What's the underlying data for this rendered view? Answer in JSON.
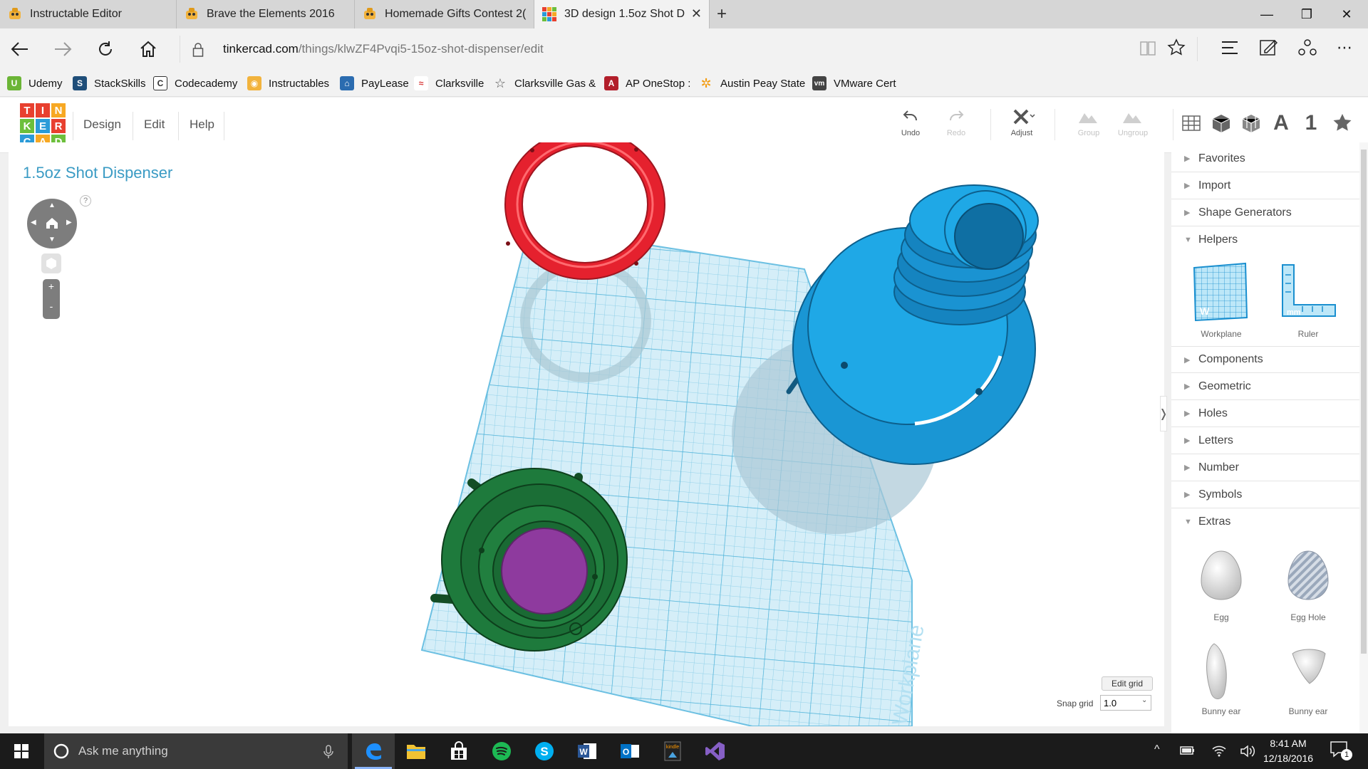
{
  "browser": {
    "tabs": [
      {
        "title": "Instructable Editor",
        "active": false
      },
      {
        "title": "Brave the Elements 2016",
        "active": false
      },
      {
        "title": "Homemade Gifts Contest 2(",
        "active": false
      },
      {
        "title": "3D design 1.5oz Shot D",
        "active": true
      }
    ],
    "new_tab_label": "+",
    "url_host": "tinkercad.com",
    "url_path": "/things/klwZF4Pvqi5-15oz-shot-dispenser/edit",
    "favorites": [
      {
        "label": "Udemy",
        "icon": "udemy-icon",
        "color": "#6bb536"
      },
      {
        "label": "StackSkills",
        "icon": "stackskills-icon",
        "color": "#1f4e79"
      },
      {
        "label": "Codecademy",
        "icon": "codecademy-icon",
        "color": "#333333"
      },
      {
        "label": "Instructables",
        "icon": "instructables-icon",
        "color": "#f2b33d"
      },
      {
        "label": "PayLease",
        "icon": "paylease-icon",
        "color": "#2b6cb0"
      },
      {
        "label": "Clarksville",
        "icon": "clarksville-icon",
        "color": "#d83a3a"
      },
      {
        "label": "Clarksville Gas &",
        "icon": "star-icon",
        "color": "#555555"
      },
      {
        "label": "AP OneStop :",
        "icon": "ap-icon",
        "color": "#b21e2a"
      },
      {
        "label": "Austin Peay State",
        "icon": "apsu-icon",
        "color": "#f39c12"
      },
      {
        "label": "VMware Cert",
        "icon": "vmware-icon",
        "color": "#444444"
      }
    ]
  },
  "tinkercad": {
    "logo_letters": [
      "T",
      "I",
      "N",
      "K",
      "E",
      "R",
      "C",
      "A",
      "D"
    ],
    "menu": [
      "Design",
      "Edit",
      "Help"
    ],
    "tools": [
      {
        "label": "Undo",
        "enabled": true
      },
      {
        "label": "Redo",
        "enabled": false
      },
      {
        "label": "Adjust",
        "enabled": true
      },
      {
        "label": "Group",
        "enabled": false
      },
      {
        "label": "Ungroup",
        "enabled": false
      }
    ],
    "view_icons": [
      "grid-view-icon",
      "box-view-icon",
      "wireframe-view-icon",
      "text-shape-icon",
      "number-shape-icon",
      "favorites-star-icon"
    ],
    "view_letter_a": "A",
    "view_number_1": "1",
    "design_title": "1.5oz Shot Dispenser",
    "help_mark": "?",
    "zoom_in": "+",
    "zoom_out": "-",
    "workplane_watermark": "Workplane",
    "edit_grid_label": "Edit grid",
    "snap_grid_label": "Snap grid",
    "snap_grid_value": "1.0"
  },
  "sidebar": {
    "categories": [
      {
        "label": "Favorites",
        "expanded": false
      },
      {
        "label": "Import",
        "expanded": false
      },
      {
        "label": "Shape Generators",
        "expanded": false
      },
      {
        "label": "Helpers",
        "expanded": true
      },
      {
        "label": "Components",
        "expanded": false
      },
      {
        "label": "Geometric",
        "expanded": false
      },
      {
        "label": "Holes",
        "expanded": false
      },
      {
        "label": "Letters",
        "expanded": false
      },
      {
        "label": "Number",
        "expanded": false
      },
      {
        "label": "Symbols",
        "expanded": false
      },
      {
        "label": "Extras",
        "expanded": true
      }
    ],
    "helpers": [
      {
        "label": "Workplane"
      },
      {
        "label": "Ruler"
      }
    ],
    "extras": [
      {
        "label": "Egg"
      },
      {
        "label": "Egg Hole"
      },
      {
        "label": "Bunny ear"
      },
      {
        "label": "Bunny ear"
      }
    ],
    "collapse_arrow": "❭"
  },
  "taskbar": {
    "search_placeholder": "Ask me anything",
    "time": "8:41 AM",
    "date": "12/18/2016",
    "notifications_count": "1"
  }
}
